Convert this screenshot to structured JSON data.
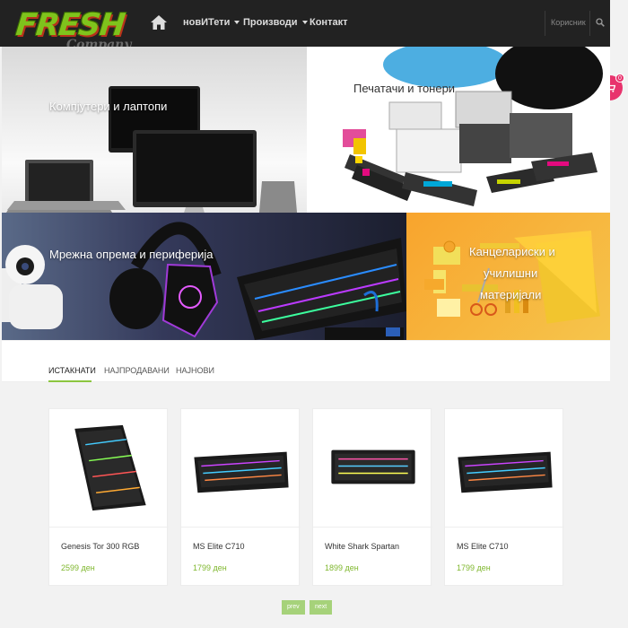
{
  "brand": {
    "logo_main": "FRESH",
    "logo_sub": "Company"
  },
  "nav": {
    "items": [
      {
        "label": "новИТети",
        "has_dropdown": true
      },
      {
        "label": "Производи",
        "has_dropdown": true
      },
      {
        "label": "Контакт",
        "has_dropdown": false
      }
    ],
    "user_label": "Корисник"
  },
  "cart": {
    "count": "0"
  },
  "banners": [
    {
      "title": "Компјутери и лаптопи"
    },
    {
      "title": "Печатачи и тонери"
    },
    {
      "title": "Мрежна опрема и периферија"
    },
    {
      "title_line1": "Канцелариски и",
      "title_line2": "училишни",
      "title_line3": "материјали"
    }
  ],
  "tabs": [
    "ИСТАКНАТИ",
    "НАЈПРОДАВАНИ",
    "НАЈНОВИ"
  ],
  "active_tab": "ИСТАКНАТИ",
  "products": [
    {
      "name": "Genesis Tor 300 RGB",
      "price": "2599 ден"
    },
    {
      "name": "MS Elite C710",
      "price": "1799 ден"
    },
    {
      "name": "White Shark Spartan",
      "price": "1899 ден"
    },
    {
      "name": "MS Elite C710",
      "price": "1799 ден"
    }
  ],
  "pagination": {
    "prev": "prev",
    "next": "next"
  },
  "colors": {
    "accent_green": "#8cc63f",
    "cart_pink": "#e8336d",
    "nav_bg": "#222222"
  }
}
